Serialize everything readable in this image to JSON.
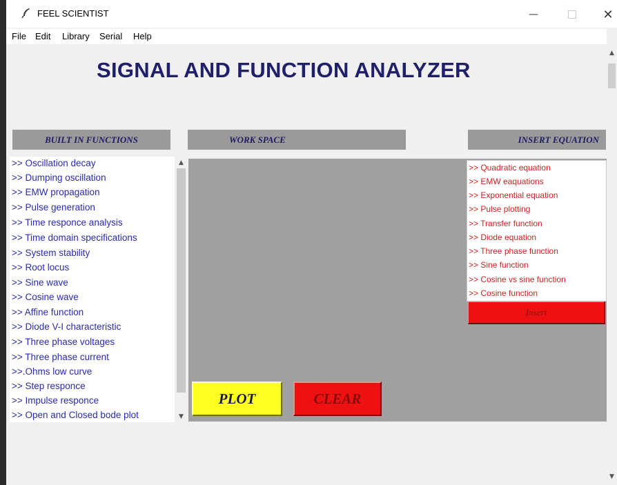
{
  "window": {
    "title": "FEEL SCIENTIST",
    "minimize_glyph": "—",
    "close_glyph": "✕"
  },
  "menu": {
    "items": [
      "File",
      "Edit",
      "Library",
      "Serial",
      "Help"
    ]
  },
  "app": {
    "title": "SIGNAL AND FUNCTION ANALYZER"
  },
  "sections": {
    "builtin_header": "BUILT IN FUNCTIONS",
    "workspace_header": "WORK SPACE",
    "insert_header": "INSERT EQUATION"
  },
  "builtin_functions": [
    ">> Oscillation decay",
    ">> Dumping oscillation",
    ">> EMW propagation",
    ">> Pulse generation",
    ">> Time responce analysis",
    ">> Time domain specifications",
    ">> System stability",
    ">> Root locus",
    ">> Sine wave",
    ">> Cosine wave",
    ">> Affine function",
    ">> Diode V-I characteristic",
    ">> Three phase voltages",
    ">> Three phase current",
    ">>.Ohms low curve",
    ">> Step responce",
    ">> Impulse responce",
    ">> Open and Closed bode plot"
  ],
  "equations": [
    ">> Quadratic equation",
    ">> EMW eaquations",
    ">> Exponential equation",
    ">> Pulse plotting",
    ">> Transfer function",
    ">> Diode equation",
    ">> Three phase function",
    ">> Sine function",
    ">> Cosine vs sine function",
    ">> Cosine function"
  ],
  "buttons": {
    "insert": "Insert",
    "plot": "PLOT",
    "clear": "CLEAR"
  },
  "scroll_glyphs": {
    "up": "▲",
    "down": "▼"
  },
  "colors": {
    "title": "#20206a",
    "builtin_text": "#2a2ab0",
    "equation_text": "#d02020",
    "plot_button": "#ffff22",
    "clear_button": "#ee1111",
    "workspace": "#a0a0a0"
  }
}
